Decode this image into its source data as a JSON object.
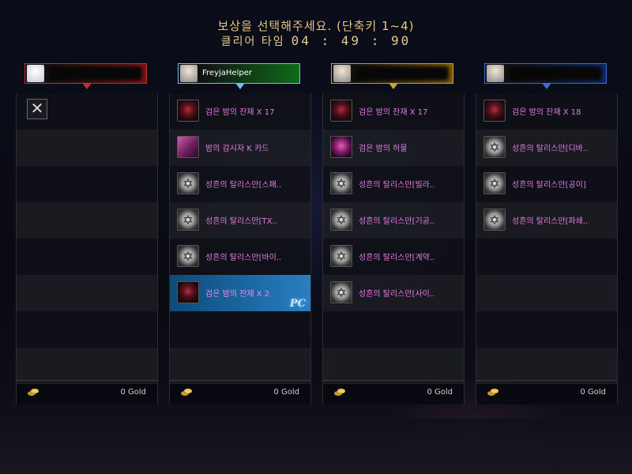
{
  "title": "보상을 선택해주세요. (단축키 1~4)",
  "timer": {
    "label": "클리어 타임",
    "value": "04 : 49 : 90"
  },
  "players": [
    {
      "name": "",
      "accent": "#7a1414",
      "border": "#b33",
      "avatar": "bunny-avatar-icon"
    },
    {
      "name": "FreyjaHelper",
      "accent": "#0f6a1a",
      "border": "#6ac0ff",
      "avatar": "white-hair-avatar-icon"
    },
    {
      "name": "",
      "accent": "#7a5a0a",
      "border": "#c9a23a",
      "avatar": "helmet-avatar-icon"
    },
    {
      "name": "",
      "accent": "#10286a",
      "border": "#3a6fd0",
      "avatar": "white-hair-avatar-icon"
    }
  ],
  "columns": [
    {
      "items": [],
      "gold": "0 Gold"
    },
    {
      "items": [
        {
          "icon": "dark-remnant-icon",
          "label": "검은 밤의 잔재 X 17"
        },
        {
          "icon": "card-icon",
          "label": "밤의 감시자 K 카드"
        },
        {
          "icon": "talisman-icon",
          "label": "성흔의 탈리스만[스패.."
        },
        {
          "icon": "talisman-icon",
          "label": "성흔의 탈리스만[TX.."
        },
        {
          "icon": "talisman-icon",
          "label": "성흔의 탈리스만[바이.."
        },
        {
          "icon": "dark-remnant-icon",
          "label": "검은 밤의 잔재 X 2",
          "selected": true
        }
      ],
      "gold": "0 Gold"
    },
    {
      "items": [
        {
          "icon": "dark-remnant-icon",
          "label": "검은 밤의 잔재 X 17"
        },
        {
          "icon": "dark-husk-icon",
          "label": "검은 밤의 허물"
        },
        {
          "icon": "talisman-icon",
          "label": "성흔의 탈리스만[빌라.."
        },
        {
          "icon": "talisman-icon",
          "label": "성흔의 탈리스만[기공.."
        },
        {
          "icon": "talisman-icon",
          "label": "성흔의 탈리스만[계약.."
        },
        {
          "icon": "talisman-icon",
          "label": "성흔의 탈리스만[사이.."
        }
      ],
      "gold": "0 Gold"
    },
    {
      "items": [
        {
          "icon": "dark-remnant-icon",
          "label": "검은 밤의 잔재 X 18"
        },
        {
          "icon": "talisman-icon",
          "label": "성흔의 탈리스만[디바.."
        },
        {
          "icon": "talisman-icon",
          "label": "성흔의 탈리스만[공이]"
        },
        {
          "icon": "talisman-icon",
          "label": "성흔의 탈리스만[파쇄.."
        }
      ],
      "gold": "0 Gold"
    }
  ],
  "selected_badge": "PC"
}
